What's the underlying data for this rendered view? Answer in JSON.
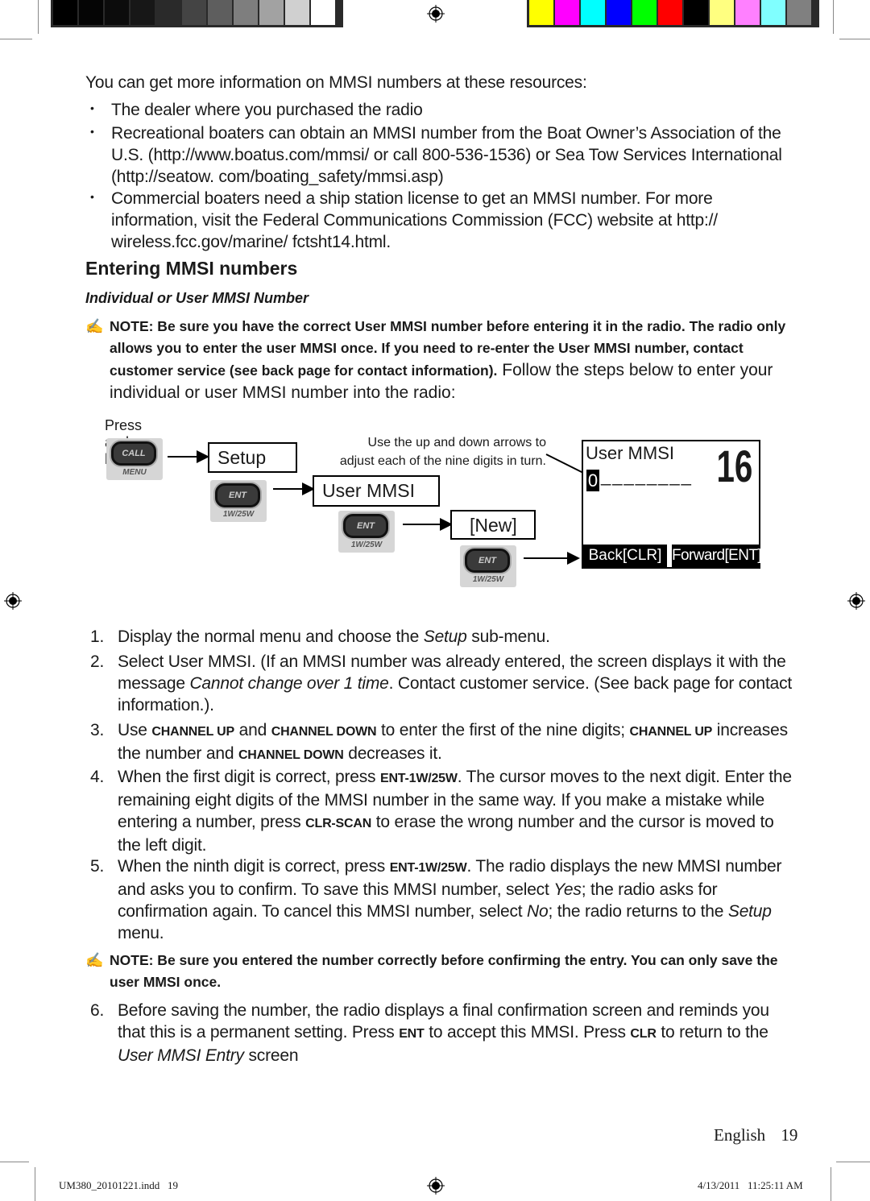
{
  "print_marks": {
    "gray_swatches": [
      "#000000",
      "#050505",
      "#0c0c0c",
      "#171717",
      "#2a2a2a",
      "#444444",
      "#5e5e5e",
      "#7e7e7e",
      "#a2a2a2",
      "#d0d0d0",
      "#ffffff"
    ],
    "color_swatches": [
      "#ffff00",
      "#ff00ff",
      "#00ffff",
      "#0000ff",
      "#00ff00",
      "#ff0000",
      "#000000",
      "#ffff80",
      "#ff80ff",
      "#80ffff",
      "#808080"
    ]
  },
  "intro": "You can get more information on MMSI numbers at these resources:",
  "resources": [
    "The dealer where you purchased the radio",
    "Recreational boaters can obtain an MMSI number from the Boat Owner’s Association of the U.S. (http://www.boatus.com/mmsi/ or call 800-536-1536) or Sea Tow Services International (http://seatow. com/boating_safety/mmsi.asp)",
    "Commercial boaters need a ship station license to get an MMSI number. For more information, visit the Federal Communications Commission (FCC) website at http:// wireless.fcc.gov/marine/ fctsht14.html."
  ],
  "section_heading": "Entering MMSI numbers",
  "subheading": "Individual or User MMSI Number",
  "note1": {
    "bold": "NOTE: Be sure you have the correct User MMSI number before entering it in the radio. The radio only allows you to enter the user MMSI once. If you need to re-enter the User MMSI number, contact customer service (see back page for contact information).",
    "normal": " Follow the steps below to enter your individual or user MMSI number into the radio:"
  },
  "diagram": {
    "press_hold": "Press and hold -",
    "call_button": {
      "cap": "CALL",
      "label": "MENU"
    },
    "ent_button": {
      "cap": "ENT",
      "label": "1W/25W"
    },
    "menu_setup": "Setup",
    "menu_user_mmsi": "User MMSI",
    "menu_new": "[New]",
    "callout": "Use the up and down arrows to adjust each of the nine digits in turn.",
    "lcd": {
      "title": "User MMSI",
      "channel": "16",
      "cursor_digit": "0",
      "blanks": "________",
      "back": "Back[CLR]",
      "forward": "Forward[ENT]"
    }
  },
  "steps": [
    {
      "n": "1.",
      "parts": [
        [
          "t",
          "Display the normal menu and choose the "
        ],
        [
          "i",
          "Setup"
        ],
        [
          "t",
          " sub-menu."
        ]
      ]
    },
    {
      "n": "2.",
      "parts": [
        [
          "t",
          "Select User MMSI. (If an MMSI number was already entered, the screen displays it with the message "
        ],
        [
          "i",
          "Cannot change over 1 time"
        ],
        [
          "t",
          ". Contact customer service. (See back page for contact information.)."
        ]
      ]
    },
    {
      "n": "3.",
      "parts": [
        [
          "t",
          "Use "
        ],
        [
          "k",
          "CHANNEL UP"
        ],
        [
          "t",
          " and "
        ],
        [
          "k",
          "CHANNEL DOWN"
        ],
        [
          "t",
          "  to enter the first of the nine digits; "
        ],
        [
          "k",
          "CHANNEL UP"
        ],
        [
          "t",
          " increases the number and "
        ],
        [
          "k",
          "CHANNEL DOWN"
        ],
        [
          "t",
          " decreases it."
        ]
      ]
    },
    {
      "n": "4.",
      "parts": [
        [
          "t",
          "When the first digit is correct, press "
        ],
        [
          "k",
          "ENT-1W/25W"
        ],
        [
          "t",
          ". The cursor moves to the next digit. Enter the remaining eight digits of the MMSI number in the same way.  If you make a mistake while entering a number, press "
        ],
        [
          "k",
          "CLR-SCAN"
        ],
        [
          "t",
          " to erase the wrong number and the cursor is moved to the left digit."
        ]
      ]
    },
    {
      "n": "5.",
      "parts": [
        [
          "t",
          " When the ninth digit is correct, press "
        ],
        [
          "k",
          "ENT-1W/25W"
        ],
        [
          "t",
          ". The radio displays the new MMSI number and asks you to confirm. To save this MMSI number, select "
        ],
        [
          "i",
          "Yes"
        ],
        [
          "t",
          "; the radio asks for confirmation again. To cancel this MMSI number, select "
        ],
        [
          "i",
          "No"
        ],
        [
          "t",
          "; the radio returns to the "
        ],
        [
          "i",
          "Setup"
        ],
        [
          "t",
          " menu."
        ]
      ]
    },
    {
      "n": "6.",
      "parts": [
        [
          "t",
          "Before saving the number, the radio displays a final confirmation screen and reminds you that this is a permanent setting. Press "
        ],
        [
          "k",
          "ENT"
        ],
        [
          "t",
          " to accept this MMSI. Press "
        ],
        [
          "k",
          "CLR"
        ],
        [
          "t",
          " to return to the "
        ],
        [
          "i",
          "User MMSI Entry"
        ],
        [
          "t",
          " screen"
        ]
      ]
    }
  ],
  "note2": "NOTE: Be sure you entered the number correctly before confirming the entry. You can only save the user MMSI once.",
  "page_footer": {
    "language": "English",
    "page": "19"
  },
  "slug": {
    "file": "UM380_20101221.indd   19",
    "timestamp": "4/13/2011   11:25:11 AM"
  }
}
